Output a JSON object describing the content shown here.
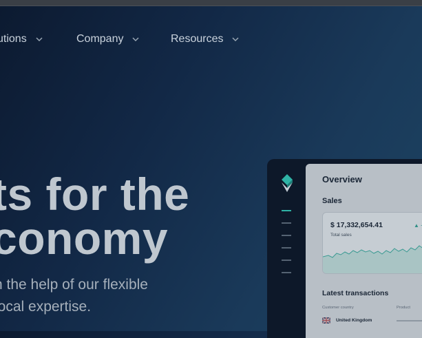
{
  "nav": {
    "items": [
      {
        "label": "utions"
      },
      {
        "label": "Company"
      },
      {
        "label": "Resources"
      }
    ]
  },
  "hero": {
    "title_line1": "ts for the",
    "title_line2": "conomy",
    "subtitle_line1": "n the help of our flexible",
    "subtitle_line2": "local expertise."
  },
  "dashboard": {
    "title": "Overview",
    "sales_label": "Sales",
    "sales_value": "$ 17,332,654.41",
    "sales_caption": "Total sales",
    "trend_text": "▲ +",
    "latest_title": "Latest transactions",
    "col_country": "Customer country",
    "col_product": "Product",
    "row_country": "United Kingdom"
  },
  "colors": {
    "accent": "#2fb3a6",
    "background": "#122846"
  },
  "icons": [
    "chevron-down-icon",
    "logo-icon",
    "uk-flag-icon"
  ]
}
